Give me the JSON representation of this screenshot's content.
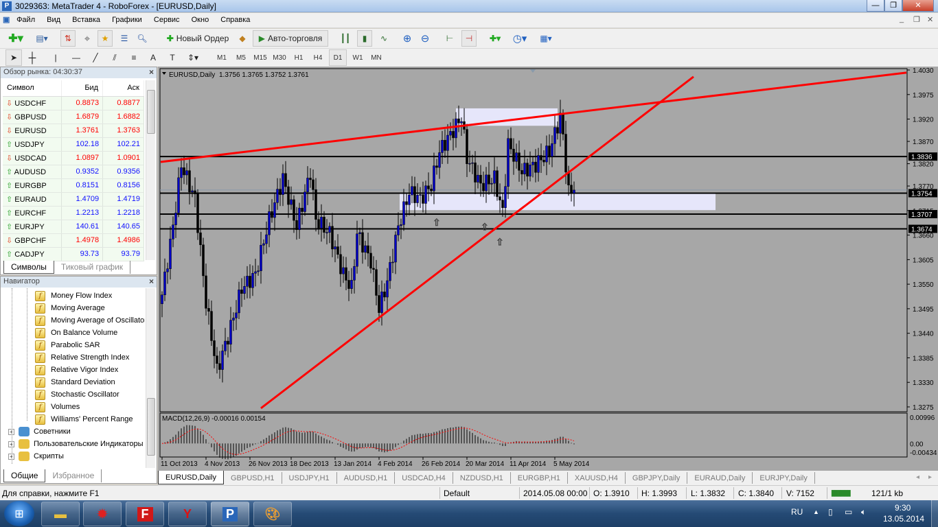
{
  "window": {
    "title": "3029363: MetaTrader 4 - RoboForex - [EURUSD,Daily]",
    "minimize": "—",
    "restore": "❐",
    "close": "✕"
  },
  "menu": [
    "Файл",
    "Вид",
    "Вставка",
    "Графики",
    "Сервис",
    "Окно",
    "Справка"
  ],
  "toolbar": {
    "new_order": "Новый Ордер",
    "auto_trading": "Авто-торговля",
    "timeframes": [
      "M1",
      "M5",
      "M15",
      "M30",
      "H1",
      "H4",
      "D1",
      "W1",
      "MN"
    ],
    "active_timeframe": "D1",
    "search_placeholder": ""
  },
  "market_watch": {
    "title": "Обзор рынка: 04:30:37",
    "columns": [
      "Символ",
      "Бид",
      "Аск"
    ],
    "rows": [
      {
        "symbol": "USDCHF",
        "bid": "0.8873",
        "ask": "0.8877",
        "dir": "down"
      },
      {
        "symbol": "GBPUSD",
        "bid": "1.6879",
        "ask": "1.6882",
        "dir": "down"
      },
      {
        "symbol": "EURUSD",
        "bid": "1.3761",
        "ask": "1.3763",
        "dir": "down"
      },
      {
        "symbol": "USDJPY",
        "bid": "102.18",
        "ask": "102.21",
        "dir": "up"
      },
      {
        "symbol": "USDCAD",
        "bid": "1.0897",
        "ask": "1.0901",
        "dir": "down"
      },
      {
        "symbol": "AUDUSD",
        "bid": "0.9352",
        "ask": "0.9356",
        "dir": "up"
      },
      {
        "symbol": "EURGBP",
        "bid": "0.8151",
        "ask": "0.8156",
        "dir": "up"
      },
      {
        "symbol": "EURAUD",
        "bid": "1.4709",
        "ask": "1.4719",
        "dir": "up"
      },
      {
        "symbol": "EURCHF",
        "bid": "1.2213",
        "ask": "1.2218",
        "dir": "up"
      },
      {
        "symbol": "EURJPY",
        "bid": "140.61",
        "ask": "140.65",
        "dir": "up"
      },
      {
        "symbol": "GBPCHF",
        "bid": "1.4978",
        "ask": "1.4986",
        "dir": "down"
      },
      {
        "symbol": "CADJPY",
        "bid": "93.73",
        "ask": "93.79",
        "dir": "up"
      }
    ],
    "tabs": [
      "Символы",
      "Тиковый график"
    ]
  },
  "navigator": {
    "title": "Навигатор",
    "indicators": [
      "Money Flow Index",
      "Moving Average",
      "Moving Average of Oscillator",
      "On Balance Volume",
      "Parabolic SAR",
      "Relative Strength Index",
      "Relative Vigor Index",
      "Standard Deviation",
      "Stochastic Oscillator",
      "Volumes",
      "Williams' Percent Range"
    ],
    "groups": [
      "Советники",
      "Пользовательские Индикаторы",
      "Скрипты"
    ],
    "tabs": [
      "Общие",
      "Избранное"
    ]
  },
  "chart_data": {
    "type": "candlestick",
    "title": "EURUSD,Daily",
    "ohlc_label": "1.3756 1.3765 1.3752 1.3761",
    "ylim": [
      1.3248,
      1.404
    ],
    "y_ticks": [
      "1.4030",
      "1.3975",
      "1.3920",
      "1.3870",
      "1.3820",
      "1.3770",
      "1.3715",
      "1.3660",
      "1.3605",
      "1.3550",
      "1.3495",
      "1.3440",
      "1.3385",
      "1.3330",
      "1.3275"
    ],
    "x_ticks": [
      {
        "idx": 0,
        "label": "11 Oct 2013"
      },
      {
        "idx": 16,
        "label": "4 Nov 2013"
      },
      {
        "idx": 32,
        "label": "26 Nov 2013"
      },
      {
        "idx": 47,
        "label": "18 Dec 2013"
      },
      {
        "idx": 63,
        "label": "13 Jan 2014"
      },
      {
        "idx": 79,
        "label": "4 Feb 2014"
      },
      {
        "idx": 95,
        "label": "26 Feb 2014"
      },
      {
        "idx": 111,
        "label": "20 Mar 2014"
      },
      {
        "idx": 127,
        "label": "11 Apr 2014"
      },
      {
        "idx": 143,
        "label": "5 May 2014"
      }
    ],
    "price_path": [
      [
        0,
        1.3526
      ],
      [
        4,
        1.3679
      ],
      [
        7,
        1.3818
      ],
      [
        12,
        1.3741
      ],
      [
        16,
        1.351
      ],
      [
        20,
        1.3356
      ],
      [
        24,
        1.3433
      ],
      [
        29,
        1.3541
      ],
      [
        34,
        1.3572
      ],
      [
        39,
        1.3695
      ],
      [
        44,
        1.3787
      ],
      [
        49,
        1.3679
      ],
      [
        54,
        1.3802
      ],
      [
        56,
        1.3695
      ],
      [
        61,
        1.3664
      ],
      [
        66,
        1.3572
      ],
      [
        69,
        1.3541
      ],
      [
        71,
        1.3664
      ],
      [
        76,
        1.3602
      ],
      [
        79,
        1.3495
      ],
      [
        82,
        1.3556
      ],
      [
        86,
        1.3679
      ],
      [
        90,
        1.3756
      ],
      [
        94,
        1.3741
      ],
      [
        98,
        1.3772
      ],
      [
        101,
        1.3848
      ],
      [
        106,
        1.3895
      ],
      [
        109,
        1.3925
      ],
      [
        111,
        1.3833
      ],
      [
        116,
        1.3772
      ],
      [
        121,
        1.3787
      ],
      [
        124,
        1.371
      ],
      [
        126,
        1.3864
      ],
      [
        131,
        1.3802
      ],
      [
        136,
        1.3818
      ],
      [
        141,
        1.3848
      ],
      [
        145,
        1.3925
      ],
      [
        146,
        1.388
      ],
      [
        148,
        1.3756
      ],
      [
        150,
        1.3761
      ]
    ],
    "hlines": [
      {
        "price": 1.3836,
        "label": "1.3836"
      },
      {
        "price": 1.3754,
        "label": "1.3754"
      },
      {
        "price": 1.3707,
        "label": "1.3707"
      },
      {
        "price": 1.3674,
        "label": "1.3674"
      }
    ],
    "bid_line": 1.3761,
    "trendlines": [
      {
        "from": [
          -0.5,
          1.3824
        ],
        "to": [
          271,
          1.4024
        ],
        "color": "#ff0000"
      },
      {
        "from": [
          36,
          1.3272
        ],
        "to": [
          193.5,
          1.4015
        ],
        "color": "#ff0000"
      }
    ],
    "zones": [
      {
        "from_idx": 86.5,
        "to_idx": 201.5,
        "top": 1.3755,
        "bottom": 1.3716
      },
      {
        "from_idx": 107,
        "to_idx": 144,
        "top": 1.3944,
        "bottom": 1.3905
      }
    ],
    "arrows": [
      {
        "idx": 100,
        "price": 1.369
      },
      {
        "idx": 117.5,
        "price": 1.368
      },
      {
        "idx": 123,
        "price": 1.3646
      }
    ],
    "macd": {
      "label": "MACD(12,26,9) -0.00016 0.00154",
      "ticks": [
        "0.00996",
        "0.00",
        "-0.00434"
      ],
      "range": [
        -0.00434,
        0.00996
      ]
    },
    "colors": {
      "bull": "#0000c8",
      "bear": "#000000",
      "trend": "#ff0000",
      "zone": "#e6e6fa",
      "bg": "#a7a7a7"
    }
  },
  "chart_tabs": [
    "EURUSD,Daily",
    "GBPUSD,H1",
    "USDJPY,H1",
    "AUDUSD,H1",
    "USDCAD,H4",
    "NZDUSD,H1",
    "EURGBP,H1",
    "XAUUSD,H4",
    "GBPJPY,Daily",
    "EURAUD,Daily",
    "EURJPY,Daily"
  ],
  "status": {
    "help": "Для справки, нажмите F1",
    "profile": "Default",
    "datetime": "2014.05.08 00:00",
    "open": "O: 1.3910",
    "high": "H: 1.3993",
    "low": "L: 1.3832",
    "close": "C: 1.3840",
    "volume": "V: 7152",
    "traffic": "121/1 kb"
  },
  "taskbar": {
    "lang": "RU",
    "time": "9:30",
    "date": "13.05.2014",
    "apps": [
      "explorer",
      "app-red-gear",
      "F",
      "yandex",
      "metatrader",
      "paint"
    ]
  }
}
